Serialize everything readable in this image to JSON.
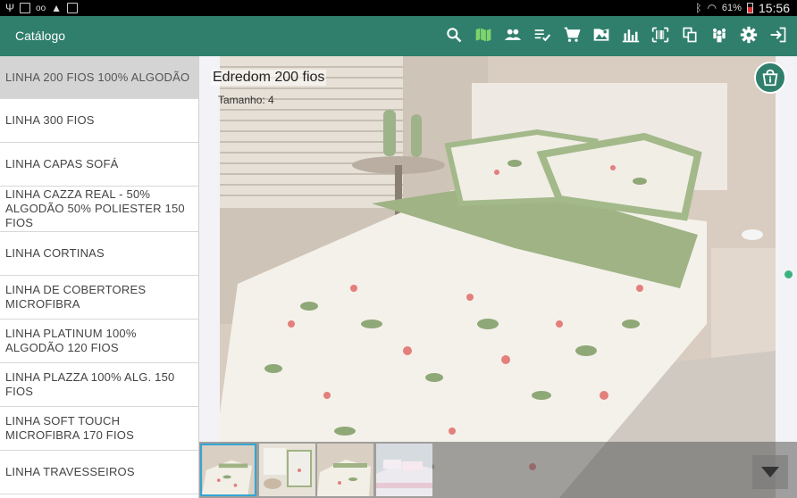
{
  "status_bar": {
    "left_icons": [
      "usb-icon",
      "image-icon",
      "voicemail-icon",
      "warning-icon",
      "bag-icon"
    ],
    "right_icons": [
      "bluetooth-icon",
      "wifi-icon"
    ],
    "battery": "61%",
    "time": "15:56"
  },
  "app_bar": {
    "title": "Catálogo",
    "actions": [
      "search-icon",
      "map-icon",
      "people-icon",
      "checklist-icon",
      "cart-icon",
      "image-location-icon",
      "bar-chart-icon",
      "barcode-icon",
      "copy-icon",
      "team-icon",
      "settings-icon",
      "logout-icon"
    ],
    "active_action": "map-icon"
  },
  "sidebar": {
    "items": [
      {
        "label": "LINHA 200 FIOS 100% ALGODÃO"
      },
      {
        "label": "LINHA 300 FIOS"
      },
      {
        "label": "LINHA CAPAS SOFÁ"
      },
      {
        "label": "LINHA CAZZA REAL - 50% ALGODÃO 50% POLIESTER 150 FIOS"
      },
      {
        "label": "LINHA CORTINAS"
      },
      {
        "label": "LINHA DE COBERTORES MICROFIBRA"
      },
      {
        "label": "LINHA PLATINUM 100% ALGODÃO 120 FIOS"
      },
      {
        "label": "LINHA PLAZZA 100% ALG. 150 FIOS"
      },
      {
        "label": "LINHA SOFT TOUCH MICROFIBRA 170 FIOS"
      },
      {
        "label": "LINHA TRAVESSEIROS"
      }
    ],
    "active_index": 0
  },
  "product": {
    "title": "Edredom 200 fios",
    "size": "Tamanho: 4",
    "thumbnails": 4,
    "selected_thumbnail": 0
  },
  "colors": {
    "primary": "#2f7f6c",
    "accent": "#3cb37f",
    "active_icon": "#7fd36b",
    "thumb_selected": "#34a5d4"
  }
}
